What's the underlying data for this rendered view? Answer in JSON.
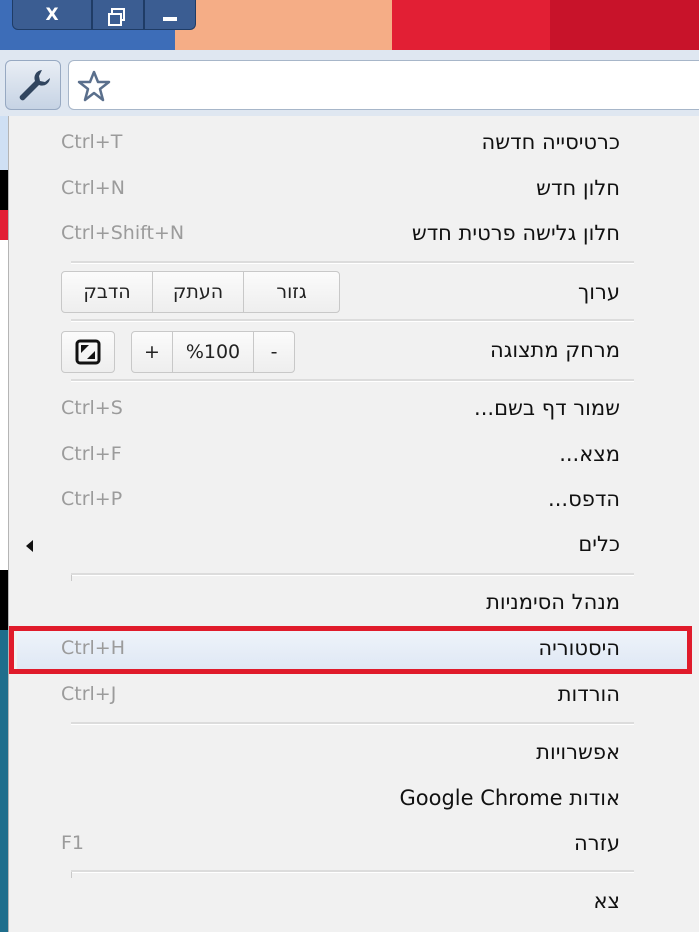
{
  "window_controls": {
    "close_glyph": "X",
    "restore_glyph": "",
    "minimize_glyph": ""
  },
  "colors": {
    "highlight": "#e01b2b",
    "shortcut_text": "#9b9b9b",
    "menu_background": "#f1f1f1"
  },
  "icons": {
    "wrench": "wrench-icon",
    "star": "star-icon",
    "fullscreen": "fullscreen-icon",
    "submenu_arrow": "submenu-arrow-icon"
  },
  "menu": {
    "new_tab": {
      "label": "כרטיסייה חדשה",
      "shortcut": "Ctrl+T"
    },
    "new_window": {
      "label": "חלון חדש",
      "shortcut": "Ctrl+N"
    },
    "new_incognito": {
      "label": "חלון גלישה פרטית חדש",
      "shortcut": "Ctrl+Shift+N"
    },
    "edit": {
      "label": "ערוך",
      "cut": "גזור",
      "copy": "העתק",
      "paste": "הדבק"
    },
    "zoom": {
      "label": "מרחק מתצוגה",
      "minus": "-",
      "value": "%100",
      "plus": "+"
    },
    "save_page": {
      "label": "שמור דף בשם...",
      "shortcut": "Ctrl+S"
    },
    "find": {
      "label": "מצא...",
      "shortcut": "Ctrl+F"
    },
    "print": {
      "label": "הדפס...",
      "shortcut": "Ctrl+P"
    },
    "tools": {
      "label": "כלים"
    },
    "bookmark_manager": {
      "label": "מנהל הסימניות"
    },
    "history": {
      "label": "היסטוריה",
      "shortcut": "Ctrl+H"
    },
    "downloads": {
      "label": "הורדות",
      "shortcut": "Ctrl+J"
    },
    "options": {
      "label": "אפשרויות"
    },
    "about": {
      "label": "אודות Google Chrome"
    },
    "help": {
      "label": "עזרה",
      "shortcut": "F1"
    },
    "exit": {
      "label": "צא"
    }
  }
}
